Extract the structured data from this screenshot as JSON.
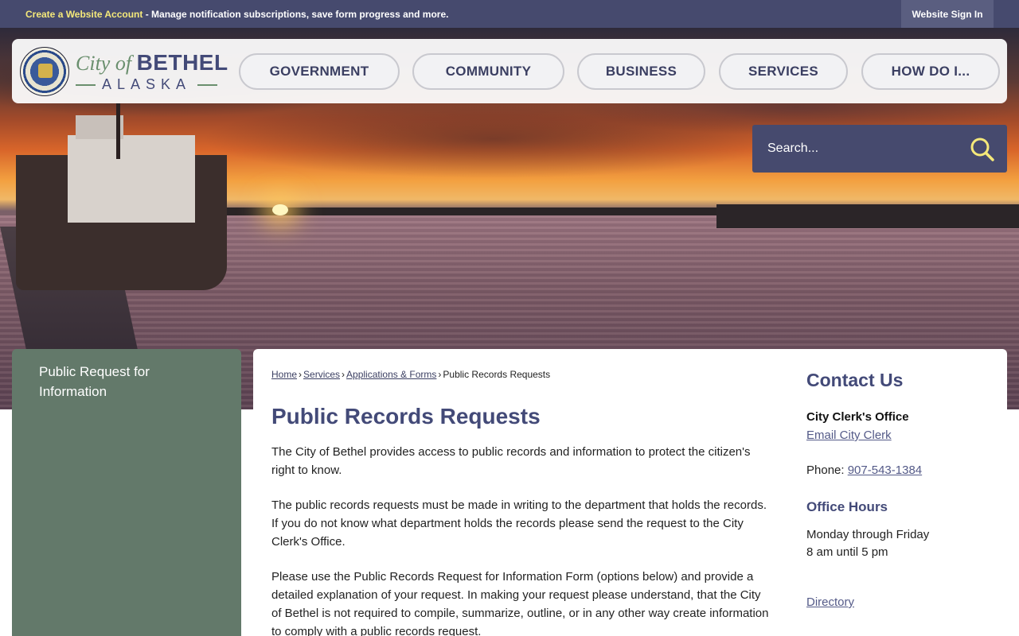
{
  "topbar": {
    "create_account_label": "Create a Website Account",
    "message": " - Manage notification subscriptions, save form progress and more.",
    "signin_label": "Website Sign In"
  },
  "brand": {
    "city_of": "City of ",
    "name": "BETHEL",
    "state": "ALASKA"
  },
  "nav": {
    "items": [
      "GOVERNMENT",
      "COMMUNITY",
      "BUSINESS",
      "SERVICES",
      "HOW DO I..."
    ]
  },
  "search": {
    "placeholder": "Search..."
  },
  "sidebar": {
    "item_label": "Public Request for Information"
  },
  "breadcrumb": {
    "home": "Home",
    "services": "Services",
    "forms": "Applications & Forms",
    "current": "Public Records Requests"
  },
  "page": {
    "title": "Public Records Requests",
    "paragraphs": [
      "The City of Bethel provides access to public records and information to protect the citizen's right to know.",
      "The public records requests must be made in writing to the department that holds the records. If you do not know what department holds the records please send the request to the City Clerk's Office.",
      "Please use the Public Records Request for Information Form (options below) and provide a detailed explanation of your request. In making your request please understand, that the City of Bethel is not required to compile, summarize, outline, or in any other way create information to comply with a public records request."
    ]
  },
  "contact": {
    "title": "Contact Us",
    "office": "City Clerk's Office",
    "email_label": "Email City Clerk",
    "phone_prefix": "Phone: ",
    "phone": "907-543-1384",
    "hours_title": "Office Hours",
    "hours_line1": "Monday through Friday",
    "hours_line2": "8 am until 5 pm",
    "directory_label": "Directory"
  },
  "colors": {
    "topbar": "#464a6e",
    "accent": "#434a78",
    "sidebar": "#63796a",
    "link_highlight": "#f5e97a"
  }
}
